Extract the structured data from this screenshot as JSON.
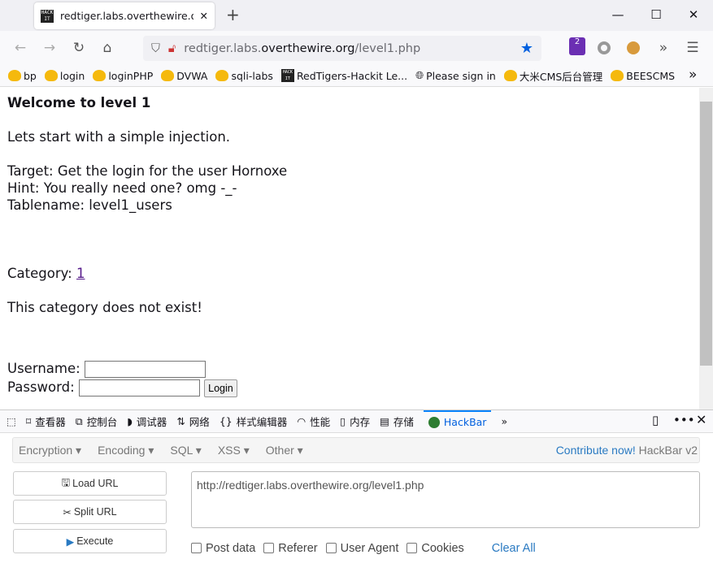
{
  "tab": {
    "title": "redtiger.labs.overthewire.org/",
    "favicon_text": "HACK IT"
  },
  "window": {
    "minimize": "—",
    "maximize": "☐",
    "close": "✕"
  },
  "nav": {
    "url_prefix": "redtiger.labs.",
    "url_domain": "overthewire.org",
    "url_path": "/level1.php",
    "extensions_badge": "2"
  },
  "bookmarks": [
    "bp",
    "login",
    "loginPHP",
    "DVWA",
    "sqli-labs",
    "RedTigers-Hackit Le...",
    "Please sign in",
    "大米CMS后台管理",
    "BEESCMS"
  ],
  "page": {
    "heading": "Welcome to level 1",
    "intro": "Lets start with a simple injection.",
    "target": "Target: Get the login for the user Hornoxe",
    "hint": "Hint: You really need one? omg -_-",
    "tablename": "Tablename: level1_users",
    "category_label": "Category: ",
    "category_link": "1",
    "message": "This category does not exist!",
    "username_label": "Username:",
    "password_label": "Password:",
    "login_button": "Login"
  },
  "devtools": {
    "tabs": [
      "查看器",
      "控制台",
      "调试器",
      "网络",
      "样式编辑器",
      "性能",
      "内存",
      "存储",
      "HackBar"
    ],
    "active": "HackBar"
  },
  "hackbar": {
    "menus": [
      "Encryption",
      "Encoding",
      "SQL",
      "XSS",
      "Other"
    ],
    "contribute": "Contribute now!",
    "version": "HackBar v2",
    "load_url": "Load URL",
    "split_url": "Split URL",
    "execute": "Execute",
    "url_value": "http://redtiger.labs.overthewire.org/level1.php",
    "checkboxes": [
      "Post data",
      "Referer",
      "User Agent",
      "Cookies"
    ],
    "clear_all": "Clear All"
  },
  "colors": {
    "accent": "#0a84ff",
    "link_blue": "#2a7ac2"
  }
}
